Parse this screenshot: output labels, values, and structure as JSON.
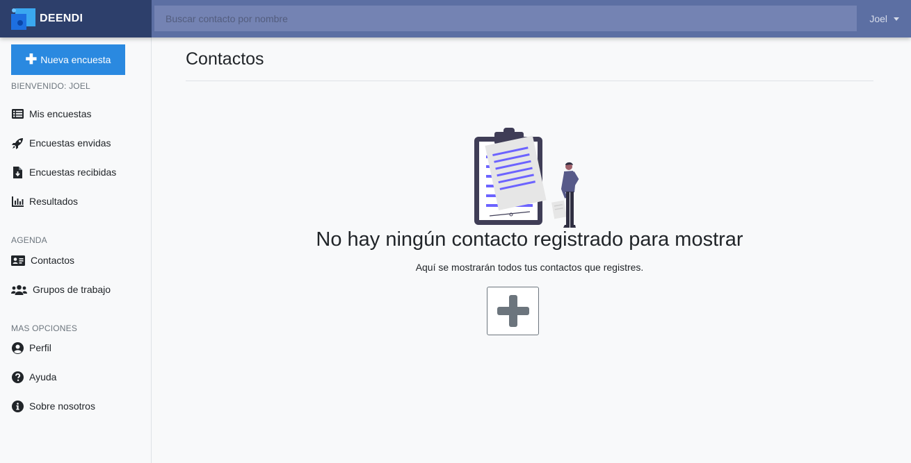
{
  "brand": {
    "name": "DEENDI"
  },
  "search": {
    "placeholder": "Buscar contacto por nombre",
    "value": ""
  },
  "user": {
    "name": "Joel"
  },
  "sidebar": {
    "new_survey_label": "Nueva encuesta",
    "welcome": "BIENVENIDO: JOEL",
    "items": [
      {
        "label": "Mis encuestas",
        "icon": "list-icon"
      },
      {
        "label": "Encuestas envidas",
        "icon": "rocket-icon"
      },
      {
        "label": "Encuestas recibidas",
        "icon": "file-download-icon"
      },
      {
        "label": "Resultados",
        "icon": "chart-bar-icon"
      }
    ],
    "agenda_label": "AGENDA",
    "agenda_items": [
      {
        "label": "Contactos",
        "icon": "address-card-icon"
      },
      {
        "label": "Grupos de trabajo",
        "icon": "users-icon"
      }
    ],
    "more_label": "MAS OPCIONES",
    "more_items": [
      {
        "label": "Perfil",
        "icon": "user-circle-icon"
      },
      {
        "label": "Ayuda",
        "icon": "question-circle-icon"
      },
      {
        "label": "Sobre nosotros",
        "icon": "info-circle-icon"
      }
    ]
  },
  "main": {
    "title": "Contactos",
    "empty_title": "No hay ningún contacto registrado para mostrar",
    "empty_subtitle": "Aquí se mostrarán todos tus contactos que registres."
  },
  "colors": {
    "navbar": "#5c6fa3",
    "brand_bg": "#2d3f6b",
    "primary_button": "#2a89e0",
    "illustration_accent": "#6c63ff"
  }
}
